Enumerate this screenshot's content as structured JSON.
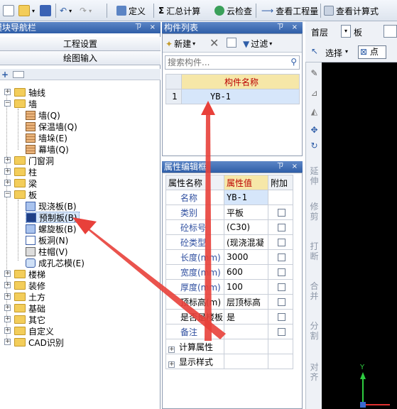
{
  "toolbar": {
    "define": "定义",
    "sum_calc": "汇总计算",
    "cloud_check": "云检查",
    "view_quantity": "查看工程量",
    "view_formula": "查看计算式"
  },
  "nav": {
    "title": "模块导航栏",
    "pin": "ㄗ ×",
    "project_settings": "工程设置",
    "drawing_input": "绘图输入",
    "items": {
      "axis": "轴线",
      "wall": "墙",
      "wall_children": [
        "墙(Q)",
        "保温墙(Q)",
        "墙垛(E)",
        "幕墙(Q)"
      ],
      "door_window": "门窗洞",
      "column": "柱",
      "beam": "梁",
      "slab": "板",
      "slab_children": [
        "现浇板(B)",
        "预制板(B)",
        "螺旋板(B)",
        "板洞(N)",
        "柱帽(V)",
        "成孔芯模(E)"
      ],
      "stair": "楼梯",
      "decoration": "装修",
      "earthwork": "土方",
      "foundation": "基础",
      "other": "其它",
      "custom": "自定义",
      "cad": "CAD识别"
    }
  },
  "component_list": {
    "title": "构件列表",
    "pin": "ㄗ ×",
    "new_label": "新建",
    "filter_label": "过滤",
    "search_placeholder": "搜索构件...",
    "col_name": "构件名称",
    "rows": [
      {
        "idx": "1",
        "name": "YB-1"
      }
    ]
  },
  "props": {
    "title": "属性编辑框",
    "pin": "ㄗ ×",
    "col_name": "属性名称",
    "col_value": "属性值",
    "col_extra": "附加",
    "rows": [
      {
        "name": "名称",
        "value": "YB-1"
      },
      {
        "name": "类别",
        "value": "平板"
      },
      {
        "name": "砼标号",
        "value": "(C30)"
      },
      {
        "name": "砼类型",
        "value": "(现浇混凝"
      },
      {
        "name": "长度(mm)",
        "value": "3000"
      },
      {
        "name": "宽度(mm)",
        "value": "600"
      },
      {
        "name": "厚度(mm)",
        "value": "100"
      },
      {
        "name": "顶标高(m)",
        "value": "层顶标高"
      },
      {
        "name": "是否是楼板",
        "value": "是"
      },
      {
        "name": "备注",
        "value": ""
      }
    ],
    "groups": [
      "计算属性",
      "显示样式"
    ]
  },
  "canvas": {
    "floor": "首层",
    "type": "板",
    "select": "选择",
    "point": "点"
  },
  "vtools": [
    "延伸",
    "修剪",
    "打断",
    "合并",
    "分割",
    "对齐"
  ],
  "colors": {
    "title_bar": "#3a68b0",
    "selected_row": "#d6e6fa",
    "header_yellow": "#f6e7a8",
    "arrow": "#e8403a"
  }
}
